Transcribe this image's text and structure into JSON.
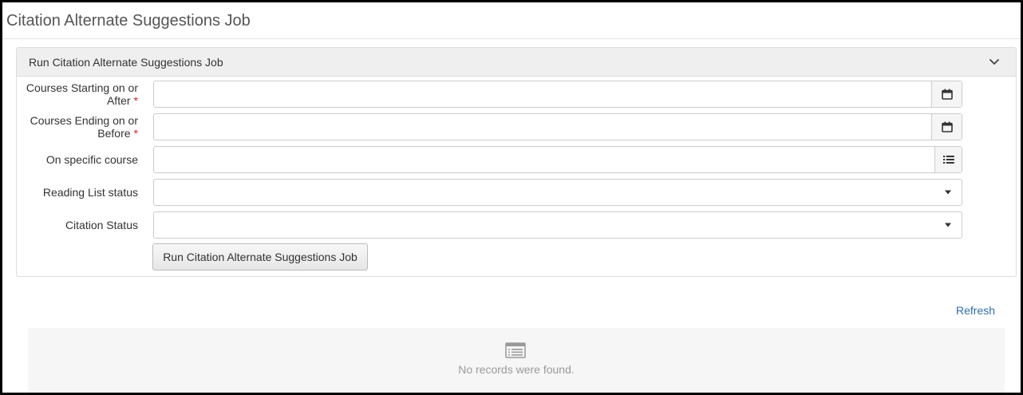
{
  "page": {
    "title": "Citation Alternate Suggestions Job"
  },
  "panel": {
    "header": "Run Citation Alternate Suggestions Job",
    "fields": [
      {
        "label": "Courses Starting on or After",
        "required": true,
        "value": "",
        "addon_icon": "calendar-icon"
      },
      {
        "label": "Courses Ending on or Before",
        "required": true,
        "value": "",
        "addon_icon": "calendar-icon"
      },
      {
        "label": "On specific course",
        "required": false,
        "value": "",
        "addon_icon": "list-icon"
      },
      {
        "label": "Reading List status",
        "required": false,
        "value": "",
        "addon_icon": "caret-down-icon"
      },
      {
        "label": "Citation Status",
        "required": false,
        "value": "",
        "addon_icon": "caret-down-icon"
      }
    ],
    "required_marker": "*",
    "run_button_label": "Run Citation Alternate Suggestions Job"
  },
  "results": {
    "refresh_label": "Refresh",
    "empty_message": "No records were found.",
    "empty_icon": "list-view-icon"
  },
  "colors": {
    "link": "#2f6fb0",
    "required": "#c62828",
    "panel_header_bg": "#efefef",
    "empty_bg": "#f6f6f6"
  }
}
